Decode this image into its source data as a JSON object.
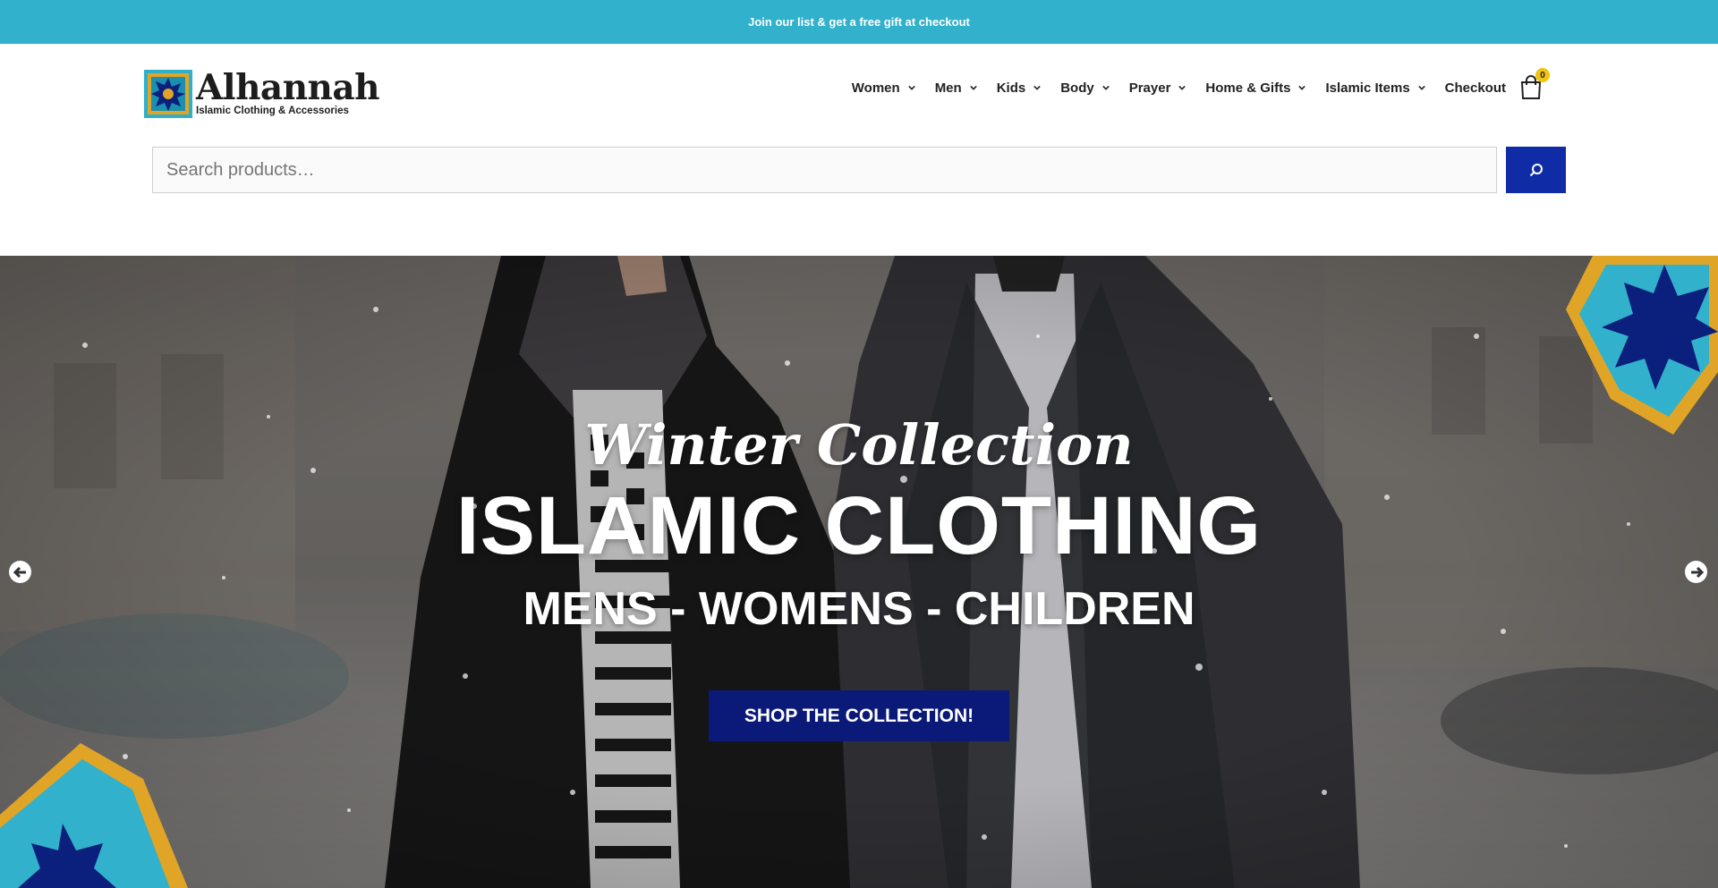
{
  "announcement": {
    "text": "Join our list & get a free gift at checkout"
  },
  "brand": {
    "name": "Alhannah",
    "tagline": "Islamic Clothing & Accessories"
  },
  "nav": {
    "items": [
      {
        "label": "Women",
        "has_dropdown": true
      },
      {
        "label": "Men",
        "has_dropdown": true
      },
      {
        "label": "Kids",
        "has_dropdown": true
      },
      {
        "label": "Body",
        "has_dropdown": true
      },
      {
        "label": "Prayer",
        "has_dropdown": true
      },
      {
        "label": "Home & Gifts",
        "has_dropdown": true
      },
      {
        "label": "Islamic Items",
        "has_dropdown": true
      },
      {
        "label": "Checkout",
        "has_dropdown": false
      }
    ],
    "cart_count": "0"
  },
  "search": {
    "placeholder": "Search products…",
    "value": ""
  },
  "hero": {
    "script_title": "Winter Collection",
    "main_title": "ISLAMIC CLOTHING",
    "subtitle": "MENS - WOMENS - CHILDREN",
    "cta_label": "SHOP THE COLLECTION!"
  },
  "colors": {
    "announcement_bg": "#31b1cb",
    "search_button_bg": "#0f2ca6",
    "cta_bg": "#0b1a78",
    "cart_badge": "#f1c40f"
  }
}
